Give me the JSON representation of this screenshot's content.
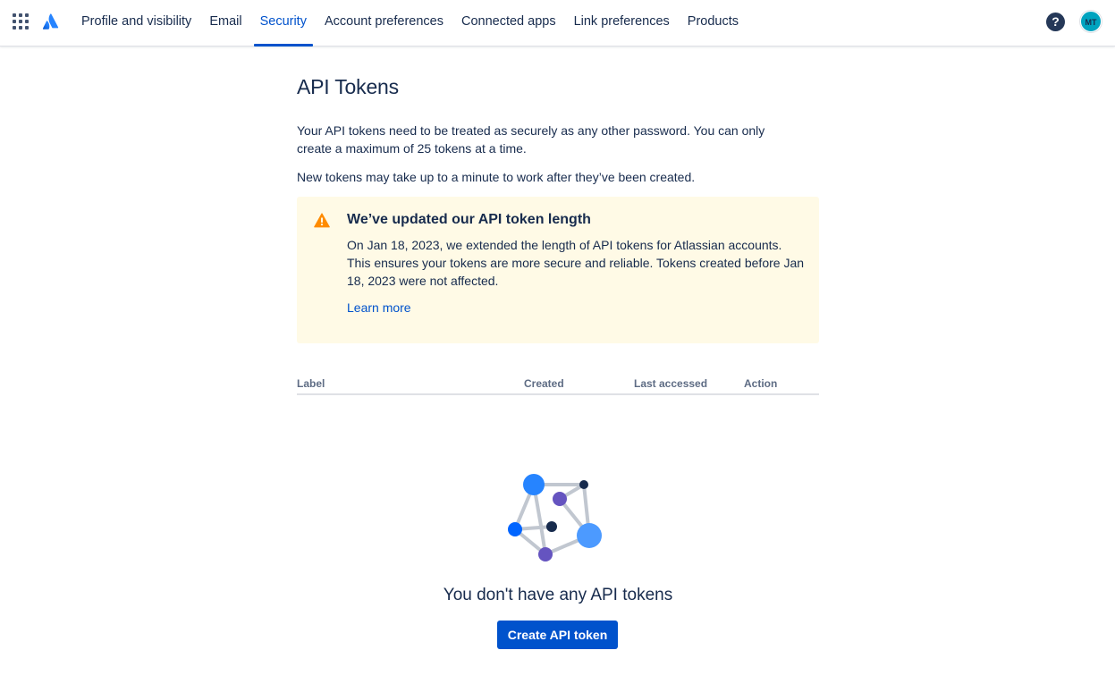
{
  "nav": {
    "tabs": [
      {
        "label": "Profile and visibility"
      },
      {
        "label": "Email"
      },
      {
        "label": "Security"
      },
      {
        "label": "Account preferences"
      },
      {
        "label": "Connected apps"
      },
      {
        "label": "Link preferences"
      },
      {
        "label": "Products"
      }
    ],
    "active_tab": "Security",
    "help_label": "?",
    "avatar_initials": "MT",
    "icons": [
      "app-switcher-icon",
      "atlassian-logo-icon",
      "help-icon"
    ]
  },
  "page": {
    "title": "API Tokens",
    "description_1": "Your API tokens need to be treated as securely as any other password. You can only create a maximum of 25 tokens at a time.",
    "description_2": "New tokens may take up to a minute to work after they’ve been created."
  },
  "banner": {
    "title": "We’ve updated our API token length",
    "text": "On Jan 18, 2023, we extended the length of API tokens for Atlassian accounts. This ensures your tokens are more secure and reliable. Tokens created before Jan 18, 2023 were not affected.",
    "link_label": "Learn more",
    "icon": "warning-icon"
  },
  "table": {
    "columns": [
      "Label",
      "Created",
      "Last accessed",
      "Action"
    ],
    "rows": []
  },
  "empty_state": {
    "title": "You don't have any API tokens",
    "button_label": "Create API token",
    "illustration": "network-graph-illustration"
  },
  "colors": {
    "brand_blue": "#0052cc",
    "banner_bg": "#fffae6",
    "warning_orange": "#ff8b00",
    "text_primary": "#172b4d",
    "text_subtle": "#5e6c84"
  }
}
